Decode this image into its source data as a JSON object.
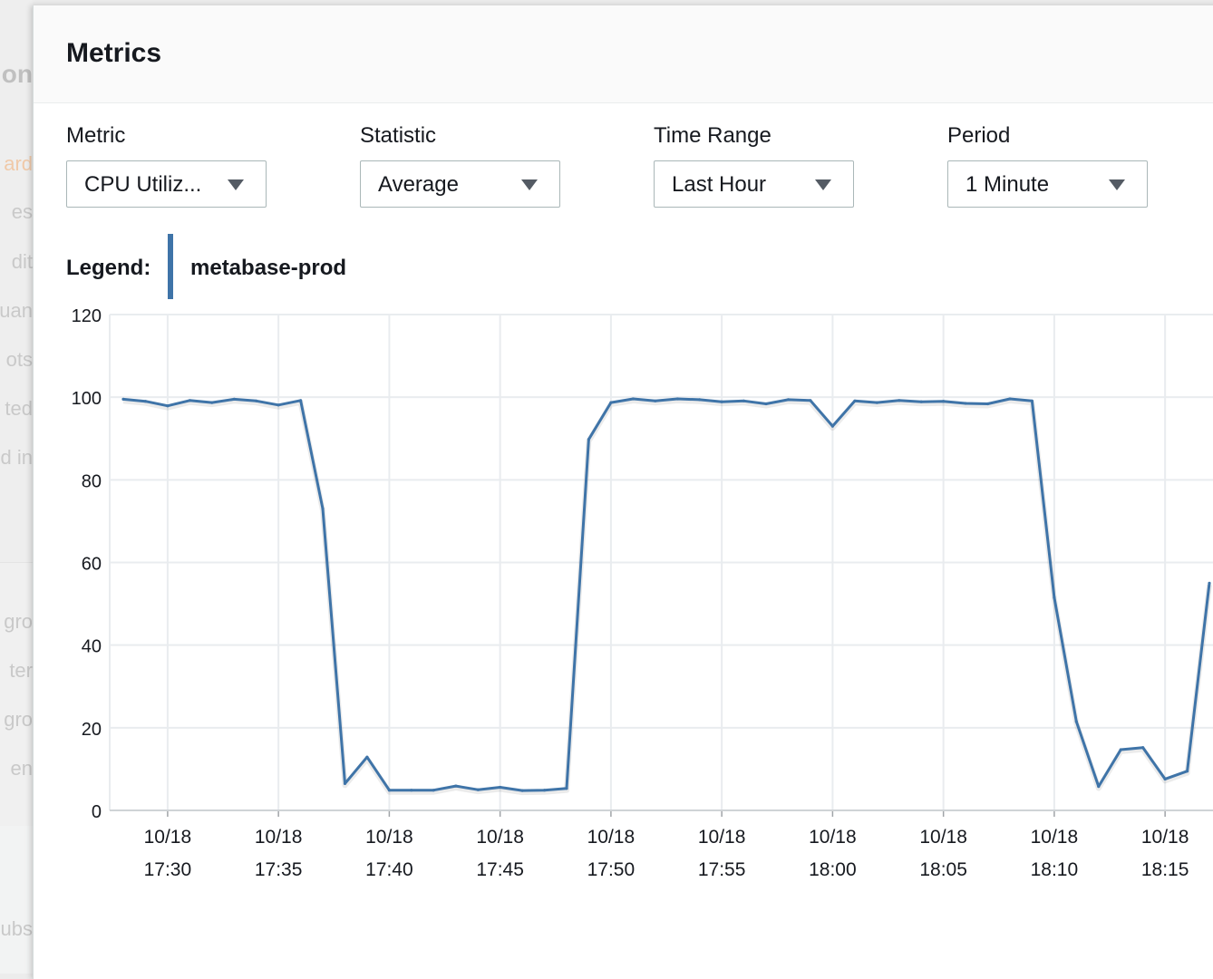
{
  "background": {
    "fragments": [
      "on",
      "ard",
      "es",
      "dit",
      "uan",
      "ots",
      "ted",
      "d in",
      "gro",
      "ter",
      "gro",
      "en",
      "ubs"
    ]
  },
  "modal": {
    "title": "Metrics"
  },
  "controls": {
    "metric": {
      "label": "Metric",
      "value": "CPU Utiliz..."
    },
    "statistic": {
      "label": "Statistic",
      "value": "Average"
    },
    "time_range": {
      "label": "Time Range",
      "value": "Last Hour"
    },
    "period": {
      "label": "Period",
      "value": "1 Minute"
    }
  },
  "legend": {
    "label": "Legend:",
    "series_name": "metabase-prod",
    "color": "#3f74a8"
  },
  "colors": {
    "series": "#3f74a8",
    "grid": "#e9ecef",
    "axis_text": "#16191f"
  },
  "chart_data": {
    "type": "line",
    "ylim": [
      0,
      120
    ],
    "y_ticks": [
      0,
      20,
      40,
      60,
      80,
      100,
      120
    ],
    "x_ticks": [
      {
        "date": "10/18",
        "time": "17:30"
      },
      {
        "date": "10/18",
        "time": "17:35"
      },
      {
        "date": "10/18",
        "time": "17:40"
      },
      {
        "date": "10/18",
        "time": "17:45"
      },
      {
        "date": "10/18",
        "time": "17:50"
      },
      {
        "date": "10/18",
        "time": "17:55"
      },
      {
        "date": "10/18",
        "time": "18:00"
      },
      {
        "date": "10/18",
        "time": "18:05"
      },
      {
        "date": "10/18",
        "time": "18:10"
      },
      {
        "date": "10/18",
        "time": "18:15"
      }
    ],
    "grid": true,
    "series": [
      {
        "name": "metabase-prod",
        "x": [
          "17:28",
          "17:29",
          "17:30",
          "17:31",
          "17:32",
          "17:33",
          "17:34",
          "17:35",
          "17:36",
          "17:37",
          "17:38",
          "17:39",
          "17:40",
          "17:41",
          "17:42",
          "17:43",
          "17:44",
          "17:45",
          "17:46",
          "17:47",
          "17:48",
          "17:49",
          "17:50",
          "17:51",
          "17:52",
          "17:53",
          "17:54",
          "17:55",
          "17:56",
          "17:57",
          "17:58",
          "17:59",
          "18:00",
          "18:01",
          "18:02",
          "18:03",
          "18:04",
          "18:05",
          "18:06",
          "18:07",
          "18:08",
          "18:09",
          "18:10",
          "18:11",
          "18:12",
          "18:13",
          "18:14",
          "18:15",
          "18:16",
          "18:17"
        ],
        "values": [
          99.5,
          99,
          97.9,
          99.2,
          98.7,
          99.5,
          99.1,
          98.1,
          99.2,
          73,
          6.5,
          12.9,
          4.9,
          4.9,
          4.9,
          5.9,
          5,
          5.6,
          4.8,
          4.9,
          5.3,
          89.8,
          98.7,
          99.6,
          99.1,
          99.6,
          99.4,
          98.9,
          99.1,
          98.4,
          99.4,
          99.2,
          93,
          99.1,
          98.7,
          99.2,
          98.9,
          99,
          98.5,
          98.4,
          99.6,
          99.1,
          51.5,
          21.5,
          5.8,
          14.7,
          15.2,
          7.6,
          9.5,
          55
        ]
      }
    ]
  }
}
